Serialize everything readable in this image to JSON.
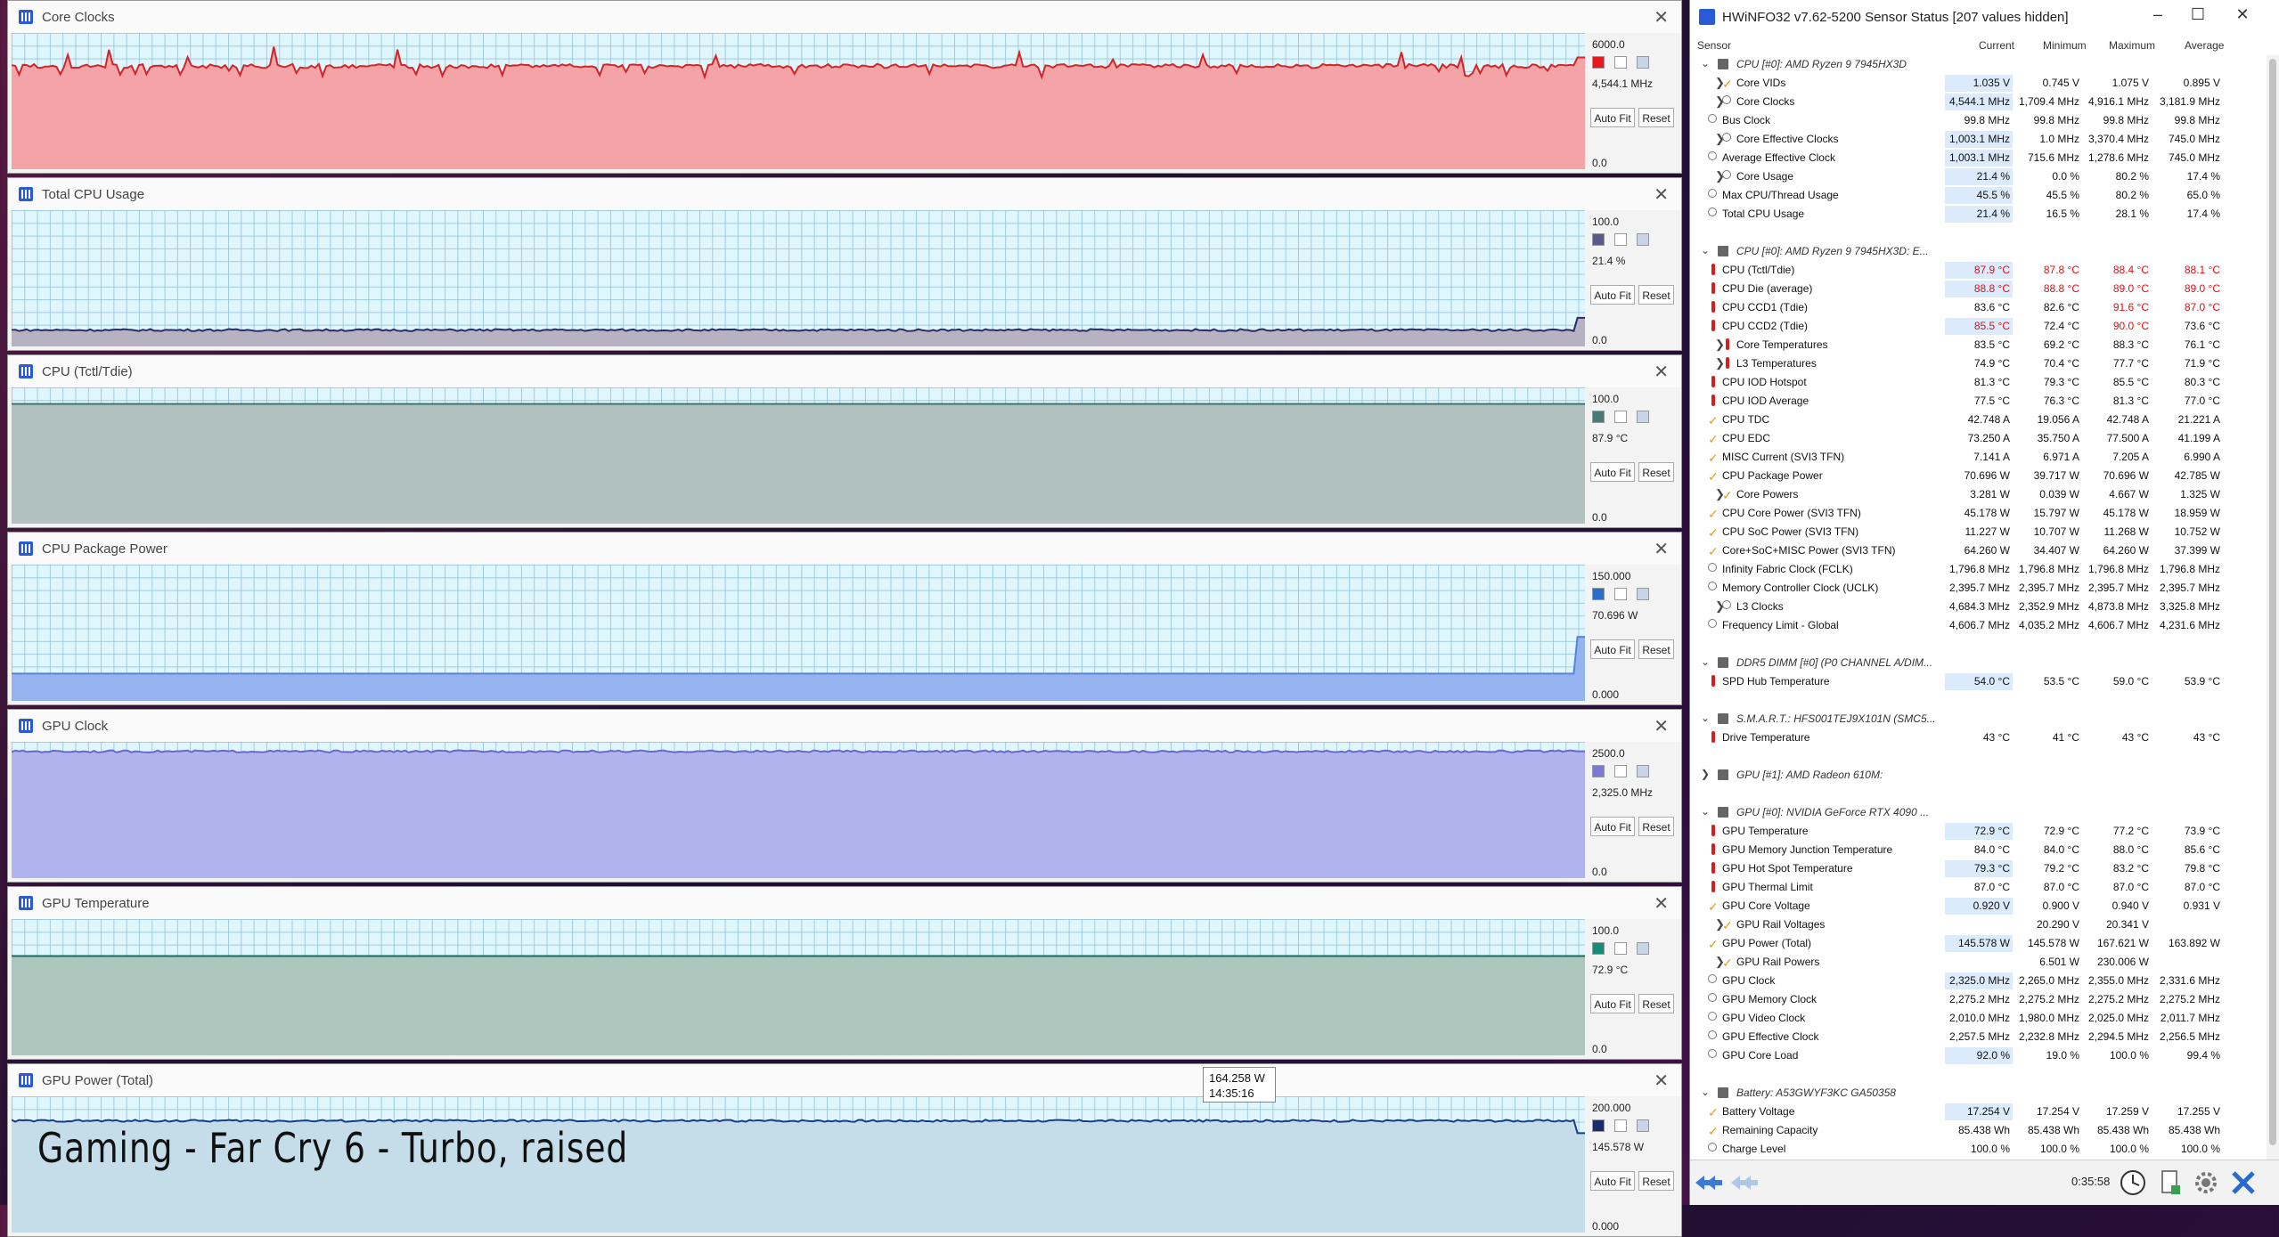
{
  "graphs": [
    {
      "title": "Core Clocks",
      "max": "6000.0",
      "current": "4,544.1 MHz",
      "min": "0.0",
      "color": "#e8191e",
      "fill": "#f4a3a6",
      "line": "#d0262a",
      "level": 0.757,
      "noise": "spiky",
      "end": 0.82
    },
    {
      "title": "Total CPU Usage",
      "max": "100.0",
      "current": "21.4 %",
      "min": "0.0",
      "color": "#5a5a8a",
      "fill": "#b7b2c2",
      "line": "#2a2a6a",
      "level": 0.12,
      "noise": "low",
      "end": 0.21
    },
    {
      "title": "CPU (Tctl/Tdie)",
      "max": "100.0",
      "current": "87.9 °C",
      "min": "0.0",
      "color": "#4a7a78",
      "fill": "#b1c1be",
      "line": "#3a6e6a",
      "level": 0.879,
      "noise": "flat",
      "end": 0.879
    },
    {
      "title": "CPU Package Power",
      "max": "150.000",
      "current": "70.696 W",
      "min": "0.000",
      "color": "#2a6dc8",
      "fill": "#94b3ef",
      "line": "#5a82d8",
      "level": 0.2,
      "noise": "flat",
      "end": 0.47
    },
    {
      "title": "GPU Clock",
      "max": "2500.0",
      "current": "2,325.0 MHz",
      "min": "0.0",
      "color": "#7a7ad0",
      "fill": "#b1b3ef",
      "line": "#6868c8",
      "level": 0.93,
      "noise": "low",
      "end": 0.93
    },
    {
      "title": "GPU Temperature",
      "max": "100.0",
      "current": "72.9 °C",
      "min": "0.0",
      "color": "#1a8a78",
      "fill": "#acc6bd",
      "line": "#1a6a5a",
      "level": 0.729,
      "noise": "flat",
      "end": 0.729
    },
    {
      "title": "GPU Power (Total)",
      "max": "200.000",
      "current": "145.578 W",
      "min": "0.000",
      "color": "#1a2a6a",
      "fill": "#c4dde9",
      "line": "#1a3a8a",
      "level": 0.82,
      "noise": "low",
      "end": 0.73
    }
  ],
  "tooltip": {
    "value": "164.258 W",
    "time": "14:35:16"
  },
  "caption": "Gaming - Far Cry 6 - Turbo, raised",
  "buttons": {
    "autofit": "Auto Fit",
    "reset": "Reset"
  },
  "hwinfo": {
    "title": "HWiNFO32 v7.62-5200 Sensor Status [207 values hidden]",
    "columns": [
      "Sensor",
      "Current",
      "Minimum",
      "Maximum",
      "Average"
    ],
    "timer": "0:35:58",
    "rows": [
      {
        "k": "group",
        "label": "CPU [#0]: AMD Ryzen 9 7945HX3D"
      },
      {
        "label": "Core VIDs",
        "icon": "volt",
        "exp": true,
        "sub": 1,
        "v": [
          "1.035 V",
          "0.745 V",
          "1.075 V",
          "0.895 V"
        ],
        "hl": true
      },
      {
        "label": "Core Clocks",
        "icon": "clock",
        "exp": true,
        "sub": 1,
        "v": [
          "4,544.1 MHz",
          "1,709.4 MHz",
          "4,916.1 MHz",
          "3,181.9 MHz"
        ],
        "hl": true
      },
      {
        "label": "Bus Clock",
        "icon": "clock",
        "v": [
          "99.8 MHz",
          "99.8 MHz",
          "99.8 MHz",
          "99.8 MHz"
        ]
      },
      {
        "label": "Core Effective Clocks",
        "icon": "clock",
        "exp": true,
        "sub": 1,
        "v": [
          "1,003.1 MHz",
          "1.0 MHz",
          "3,370.4 MHz",
          "745.0 MHz"
        ],
        "hl": true
      },
      {
        "label": "Average Effective Clock",
        "icon": "clock",
        "v": [
          "1,003.1 MHz",
          "715.6 MHz",
          "1,278.6 MHz",
          "745.0 MHz"
        ],
        "hl": true
      },
      {
        "label": "Core Usage",
        "icon": "clock",
        "exp": true,
        "sub": 1,
        "v": [
          "21.4 %",
          "0.0 %",
          "80.2 %",
          "17.4 %"
        ],
        "hl": true
      },
      {
        "label": "Max CPU/Thread Usage",
        "icon": "clock",
        "v": [
          "45.5 %",
          "45.5 %",
          "80.2 %",
          "65.0 %"
        ],
        "hl": true
      },
      {
        "label": "Total CPU Usage",
        "icon": "clock",
        "v": [
          "21.4 %",
          "16.5 %",
          "28.1 %",
          "17.4 %"
        ],
        "hl": true
      },
      {
        "k": "gap"
      },
      {
        "k": "group",
        "label": "CPU [#0]: AMD Ryzen 9 7945HX3D: E..."
      },
      {
        "label": "CPU (Tctl/Tdie)",
        "icon": "temp",
        "red": true,
        "v": [
          "87.9 °C",
          "87.8 °C",
          "88.4 °C",
          "88.1 °C"
        ],
        "hl": true
      },
      {
        "label": "CPU Die (average)",
        "icon": "temp",
        "red": true,
        "v": [
          "88.8 °C",
          "88.8 °C",
          "89.0 °C",
          "89.0 °C"
        ],
        "hl": true
      },
      {
        "label": "CPU CCD1 (Tdie)",
        "icon": "temp",
        "v": [
          "83.6 °C",
          "82.6 °C",
          "91.6 °C",
          "87.0 °C"
        ],
        "redcols": [
          2,
          3
        ]
      },
      {
        "label": "CPU CCD2 (Tdie)",
        "icon": "temp",
        "v": [
          "85.5 °C",
          "72.4 °C",
          "90.0 °C",
          "73.6 °C"
        ],
        "redcols": [
          0,
          2
        ],
        "hl": true
      },
      {
        "label": "Core Temperatures",
        "icon": "temp",
        "exp": true,
        "sub": 1,
        "v": [
          "83.5 °C",
          "69.2 °C",
          "88.3 °C",
          "76.1 °C"
        ]
      },
      {
        "label": "L3 Temperatures",
        "icon": "temp",
        "exp": true,
        "sub": 1,
        "v": [
          "74.9 °C",
          "70.4 °C",
          "77.7 °C",
          "71.9 °C"
        ]
      },
      {
        "label": "CPU IOD Hotspot",
        "icon": "temp",
        "v": [
          "81.3 °C",
          "79.3 °C",
          "85.5 °C",
          "80.3 °C"
        ]
      },
      {
        "label": "CPU IOD Average",
        "icon": "temp",
        "v": [
          "77.5 °C",
          "76.3 °C",
          "81.3 °C",
          "77.0 °C"
        ]
      },
      {
        "label": "CPU TDC",
        "icon": "volt",
        "v": [
          "42.748 A",
          "19.056 A",
          "42.748 A",
          "21.221 A"
        ]
      },
      {
        "label": "CPU EDC",
        "icon": "volt",
        "v": [
          "73.250 A",
          "35.750 A",
          "77.500 A",
          "41.199 A"
        ]
      },
      {
        "label": "MISC Current (SVI3 TFN)",
        "icon": "volt",
        "v": [
          "7.141 A",
          "6.971 A",
          "7.205 A",
          "6.990 A"
        ]
      },
      {
        "label": "CPU Package Power",
        "icon": "volt",
        "v": [
          "70.696 W",
          "39.717 W",
          "70.696 W",
          "42.785 W"
        ]
      },
      {
        "label": "Core Powers",
        "icon": "volt",
        "exp": true,
        "sub": 1,
        "v": [
          "3.281 W",
          "0.039 W",
          "4.667 W",
          "1.325 W"
        ]
      },
      {
        "label": "CPU Core Power (SVI3 TFN)",
        "icon": "volt",
        "v": [
          "45.178 W",
          "15.797 W",
          "45.178 W",
          "18.959 W"
        ]
      },
      {
        "label": "CPU SoC Power (SVI3 TFN)",
        "icon": "volt",
        "v": [
          "11.227 W",
          "10.707 W",
          "11.268 W",
          "10.752 W"
        ]
      },
      {
        "label": "Core+SoC+MISC Power (SVI3 TFN)",
        "icon": "volt",
        "v": [
          "64.260 W",
          "34.407 W",
          "64.260 W",
          "37.399 W"
        ]
      },
      {
        "label": "Infinity Fabric Clock (FCLK)",
        "icon": "clock",
        "v": [
          "1,796.8 MHz",
          "1,796.8 MHz",
          "1,796.8 MHz",
          "1,796.8 MHz"
        ]
      },
      {
        "label": "Memory Controller Clock (UCLK)",
        "icon": "clock",
        "v": [
          "2,395.7 MHz",
          "2,395.7 MHz",
          "2,395.7 MHz",
          "2,395.7 MHz"
        ]
      },
      {
        "label": "L3 Clocks",
        "icon": "clock",
        "exp": true,
        "sub": 1,
        "v": [
          "4,684.3 MHz",
          "2,352.9 MHz",
          "4,873.8 MHz",
          "3,325.8 MHz"
        ]
      },
      {
        "label": "Frequency Limit - Global",
        "icon": "clock",
        "v": [
          "4,606.7 MHz",
          "4,035.2 MHz",
          "4,606.7 MHz",
          "4,231.6 MHz"
        ]
      },
      {
        "k": "gap"
      },
      {
        "k": "group",
        "label": "DDR5 DIMM [#0] (P0 CHANNEL A/DIM..."
      },
      {
        "label": "SPD Hub Temperature",
        "icon": "temp",
        "v": [
          "54.0 °C",
          "53.5 °C",
          "59.0 °C",
          "53.9 °C"
        ],
        "hl": true
      },
      {
        "k": "gap"
      },
      {
        "k": "group",
        "label": "S.M.A.R.T.: HFS001TEJ9X101N (SMC5..."
      },
      {
        "label": "Drive Temperature",
        "icon": "temp",
        "v": [
          "43 °C",
          "41 °C",
          "43 °C",
          "43 °C"
        ]
      },
      {
        "k": "gap"
      },
      {
        "k": "group",
        "label": "GPU [#1]: AMD Radeon 610M:",
        "collapsed": true
      },
      {
        "k": "gap"
      },
      {
        "k": "group",
        "label": "GPU [#0]: NVIDIA GeForce RTX 4090 ..."
      },
      {
        "label": "GPU Temperature",
        "icon": "temp",
        "v": [
          "72.9 °C",
          "72.9 °C",
          "77.2 °C",
          "73.9 °C"
        ],
        "hl": true
      },
      {
        "label": "GPU Memory Junction Temperature",
        "icon": "temp",
        "v": [
          "84.0 °C",
          "84.0 °C",
          "88.0 °C",
          "85.6 °C"
        ]
      },
      {
        "label": "GPU Hot Spot Temperature",
        "icon": "temp",
        "v": [
          "79.3 °C",
          "79.2 °C",
          "83.2 °C",
          "79.8 °C"
        ],
        "hl": true
      },
      {
        "label": "GPU Thermal Limit",
        "icon": "temp",
        "v": [
          "87.0 °C",
          "87.0 °C",
          "87.0 °C",
          "87.0 °C"
        ]
      },
      {
        "label": "GPU Core Voltage",
        "icon": "volt",
        "v": [
          "0.920 V",
          "0.900 V",
          "0.940 V",
          "0.931 V"
        ],
        "hl": true
      },
      {
        "label": "GPU Rail Voltages",
        "icon": "volt",
        "exp": true,
        "sub": 1,
        "v": [
          "",
          "20.290 V",
          "20.341 V",
          ""
        ]
      },
      {
        "label": "GPU Power (Total)",
        "icon": "volt",
        "v": [
          "145.578 W",
          "145.578 W",
          "167.621 W",
          "163.892 W"
        ],
        "hl": true
      },
      {
        "label": "GPU Rail Powers",
        "icon": "volt",
        "exp": true,
        "sub": 1,
        "v": [
          "",
          "6.501 W",
          "230.006 W",
          ""
        ]
      },
      {
        "label": "GPU Clock",
        "icon": "clock",
        "v": [
          "2,325.0 MHz",
          "2,265.0 MHz",
          "2,355.0 MHz",
          "2,331.6 MHz"
        ],
        "hl": true
      },
      {
        "label": "GPU Memory Clock",
        "icon": "clock",
        "v": [
          "2,275.2 MHz",
          "2,275.2 MHz",
          "2,275.2 MHz",
          "2,275.2 MHz"
        ]
      },
      {
        "label": "GPU Video Clock",
        "icon": "clock",
        "v": [
          "2,010.0 MHz",
          "1,980.0 MHz",
          "2,025.0 MHz",
          "2,011.7 MHz"
        ]
      },
      {
        "label": "GPU Effective Clock",
        "icon": "clock",
        "v": [
          "2,257.5 MHz",
          "2,232.8 MHz",
          "2,294.5 MHz",
          "2,256.5 MHz"
        ]
      },
      {
        "label": "GPU Core Load",
        "icon": "clock",
        "v": [
          "92.0 %",
          "19.0 %",
          "100.0 %",
          "99.4 %"
        ],
        "hl": true
      },
      {
        "k": "gap"
      },
      {
        "k": "group",
        "label": "Battery: A53GWYF3KC GA50358"
      },
      {
        "label": "Battery Voltage",
        "icon": "volt",
        "v": [
          "17.254 V",
          "17.254 V",
          "17.259 V",
          "17.255 V"
        ],
        "hl": true
      },
      {
        "label": "Remaining Capacity",
        "icon": "volt",
        "v": [
          "85.438 Wh",
          "85.438 Wh",
          "85.438 Wh",
          "85.438 Wh"
        ]
      },
      {
        "label": "Charge Level",
        "icon": "clock",
        "v": [
          "100.0 %",
          "100.0 %",
          "100.0 %",
          "100.0 %"
        ]
      }
    ]
  }
}
